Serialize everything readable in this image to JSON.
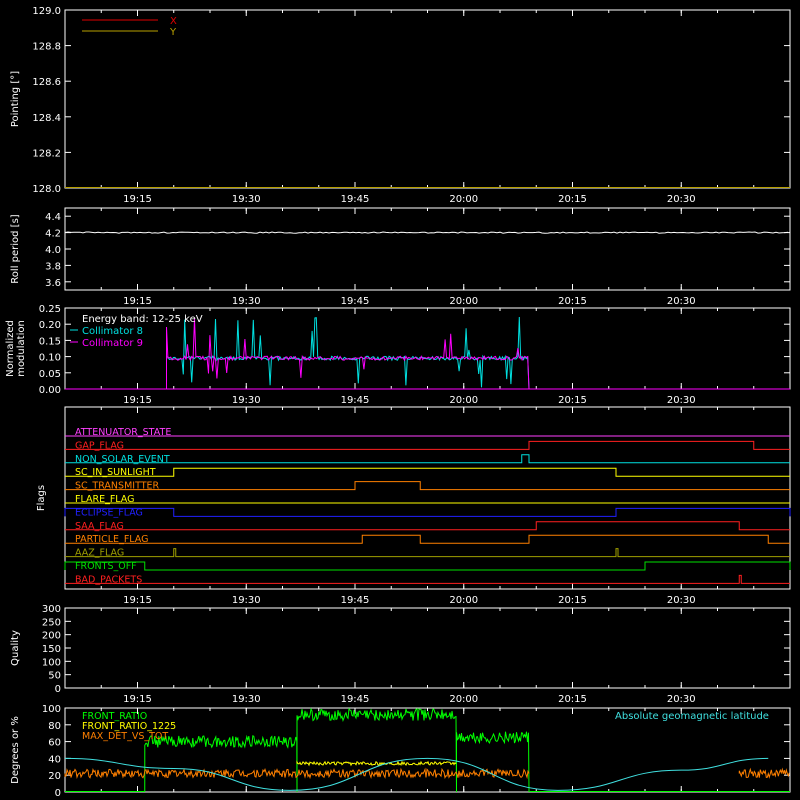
{
  "time_ticks": [
    "19:15",
    "19:30",
    "19:45",
    "20:00",
    "20:15",
    "20:30"
  ],
  "colors": {
    "axis": "#ffffff",
    "x": "#e00000",
    "y": "#b8a000",
    "coll8": "#00e0e0",
    "coll9": "#ff00ff",
    "front_ratio": "#00ff00",
    "front_ratio_1225": "#ffff00",
    "max_det": "#ff8000",
    "geolat": "#40e0e0"
  },
  "chart_data": [
    {
      "type": "line",
      "panel": "pointing",
      "ylabel": "Pointing [°]",
      "ylim": [
        128.0,
        129.0
      ],
      "yticks": [
        "128.0",
        "128.2",
        "128.4",
        "128.6",
        "128.8",
        "129.0"
      ],
      "series": [
        {
          "name": "X",
          "x": [
            "19:05",
            "20:45"
          ],
          "y": [
            128.0,
            128.0
          ]
        },
        {
          "name": "Y",
          "x": [
            "19:05",
            "20:45"
          ],
          "y": [
            128.0,
            128.0
          ]
        }
      ]
    },
    {
      "type": "line",
      "panel": "roll",
      "ylabel": "Roll period [s]",
      "ylim": [
        3.5,
        4.5
      ],
      "yticks": [
        "3.6",
        "3.8",
        "4.0",
        "4.2",
        "4.4"
      ],
      "series": [
        {
          "x": [
            "19:05",
            "20:45"
          ],
          "y": [
            4.2,
            4.2
          ]
        }
      ]
    },
    {
      "type": "line",
      "panel": "modulation",
      "ylabel": "Normalized modulation",
      "ylim": [
        0.0,
        0.25
      ],
      "yticks": [
        "0.00",
        "0.05",
        "0.10",
        "0.15",
        "0.20",
        "0.25"
      ],
      "annotation": "Energy band: 12-25 keV",
      "series": [
        {
          "name": "Collimator 8",
          "active_range": [
            "19:19",
            "20:09"
          ],
          "level": 0.095
        },
        {
          "name": "Collimator 9",
          "active_range": [
            "19:19",
            "20:09"
          ],
          "level": 0.095
        }
      ]
    },
    {
      "type": "line",
      "panel": "flags",
      "ylabel": "Flags",
      "flags": [
        {
          "name": "ATTENUATOR_STATE",
          "color": "#ff40ff",
          "on": []
        },
        {
          "name": "GAP_FLAG",
          "color": "#ff2020",
          "on": [
            [
              "20:09",
              "20:40"
            ]
          ]
        },
        {
          "name": "NON_SOLAR_EVENT",
          "color": "#00e0e0",
          "on": [
            [
              "20:08",
              "20:09"
            ]
          ]
        },
        {
          "name": "SC_IN_SUNLIGHT",
          "color": "#ffff00",
          "on": [
            [
              "19:20",
              "20:21"
            ]
          ]
        },
        {
          "name": "SC_TRANSMITTER",
          "color": "#ff8000",
          "on": [
            [
              "19:45",
              "19:54"
            ]
          ]
        },
        {
          "name": "FLARE_FLAG",
          "color": "#ffff00",
          "on": []
        },
        {
          "name": "ECLIPSE_FLAG",
          "color": "#2020ff",
          "on": [
            [
              "19:05",
              "19:20"
            ],
            [
              "20:21",
              "20:45"
            ]
          ]
        },
        {
          "name": "SAA_FLAG",
          "color": "#ff2020",
          "on": [
            [
              "20:10",
              "20:38"
            ]
          ]
        },
        {
          "name": "PARTICLE_FLAG",
          "color": "#ff8000",
          "on": [
            [
              "19:46",
              "19:54"
            ],
            [
              "20:09",
              "20:42"
            ]
          ]
        },
        {
          "name": "AAZ_FLAG",
          "color": "#a0a000",
          "on": [
            [
              "19:20",
              "19:20"
            ],
            [
              "20:21",
              "20:21"
            ]
          ]
        },
        {
          "name": "FRONTS_OFF",
          "color": "#00e000",
          "on": [
            [
              "19:05",
              "19:16"
            ],
            [
              "20:25",
              "20:45"
            ]
          ]
        },
        {
          "name": "BAD_PACKETS",
          "color": "#ff2020",
          "on": [
            [
              "20:38",
              "20:38"
            ]
          ]
        }
      ]
    },
    {
      "type": "line",
      "panel": "quality",
      "ylabel": "Quality",
      "ylim": [
        0,
        300
      ],
      "yticks": [
        "0",
        "50",
        "100",
        "150",
        "200",
        "250",
        "300"
      ],
      "series": []
    },
    {
      "type": "line",
      "panel": "ratios",
      "ylabel": "Degrees or %",
      "ylim": [
        0,
        100
      ],
      "yticks": [
        "0",
        "20",
        "40",
        "60",
        "80",
        "100"
      ],
      "annotation": "Absolute geomagnetic latitude",
      "series": [
        {
          "name": "FRONT_RATIO",
          "segments": [
            {
              "x": [
                "19:16",
                "19:37"
              ],
              "level": 60
            },
            {
              "x": [
                "19:37",
                "19:59"
              ],
              "level": 92
            },
            {
              "x": [
                "19:59",
                "20:09"
              ],
              "level": 65
            }
          ]
        },
        {
          "name": "FRONT_RATIO_1225",
          "segments": [
            {
              "x": [
                "19:37",
                "19:59"
              ],
              "level": 34
            }
          ]
        },
        {
          "name": "MAX_DET_VS_TOT",
          "segments": [
            {
              "x": [
                "19:05",
                "20:09"
              ],
              "level": 22
            },
            {
              "x": [
                "20:38",
                "20:45"
              ],
              "level": 22
            }
          ]
        },
        {
          "name": "Absolute geomagnetic latitude",
          "x": [
            "19:05",
            "19:20",
            "19:36",
            "19:55",
            "20:13",
            "20:30",
            "20:42"
          ],
          "y": [
            40,
            28,
            2,
            40,
            2,
            26,
            40
          ]
        }
      ]
    }
  ]
}
